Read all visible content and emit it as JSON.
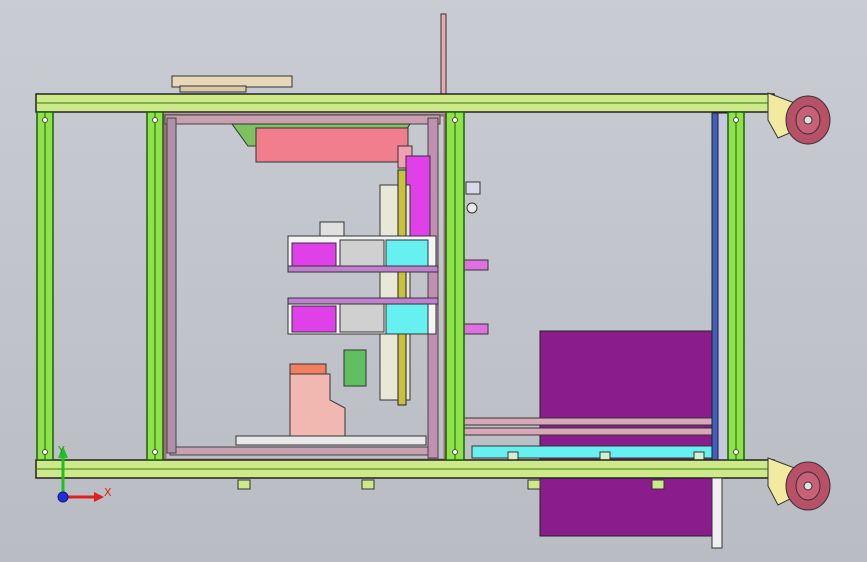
{
  "viewport": {
    "background": "#c1c5cb"
  },
  "colors": {
    "frame_green": "#8fe34a",
    "frame_green_dark": "#2f7a12",
    "frame_yellow": "#cde98a",
    "pink_panel": "#f08090",
    "magenta": "#e040e8",
    "cyan": "#66f0f0",
    "purple_block": "#8a1c8c",
    "salmon": "#f0b8b0",
    "wheel": "#b85068",
    "caster": "#f2eaa0",
    "beige": "#e6d8b8"
  },
  "triad": {
    "x_label": "X",
    "y_label": "Y",
    "x_color": "#e02020",
    "y_color": "#20c020",
    "z_color": "#2030e0"
  }
}
